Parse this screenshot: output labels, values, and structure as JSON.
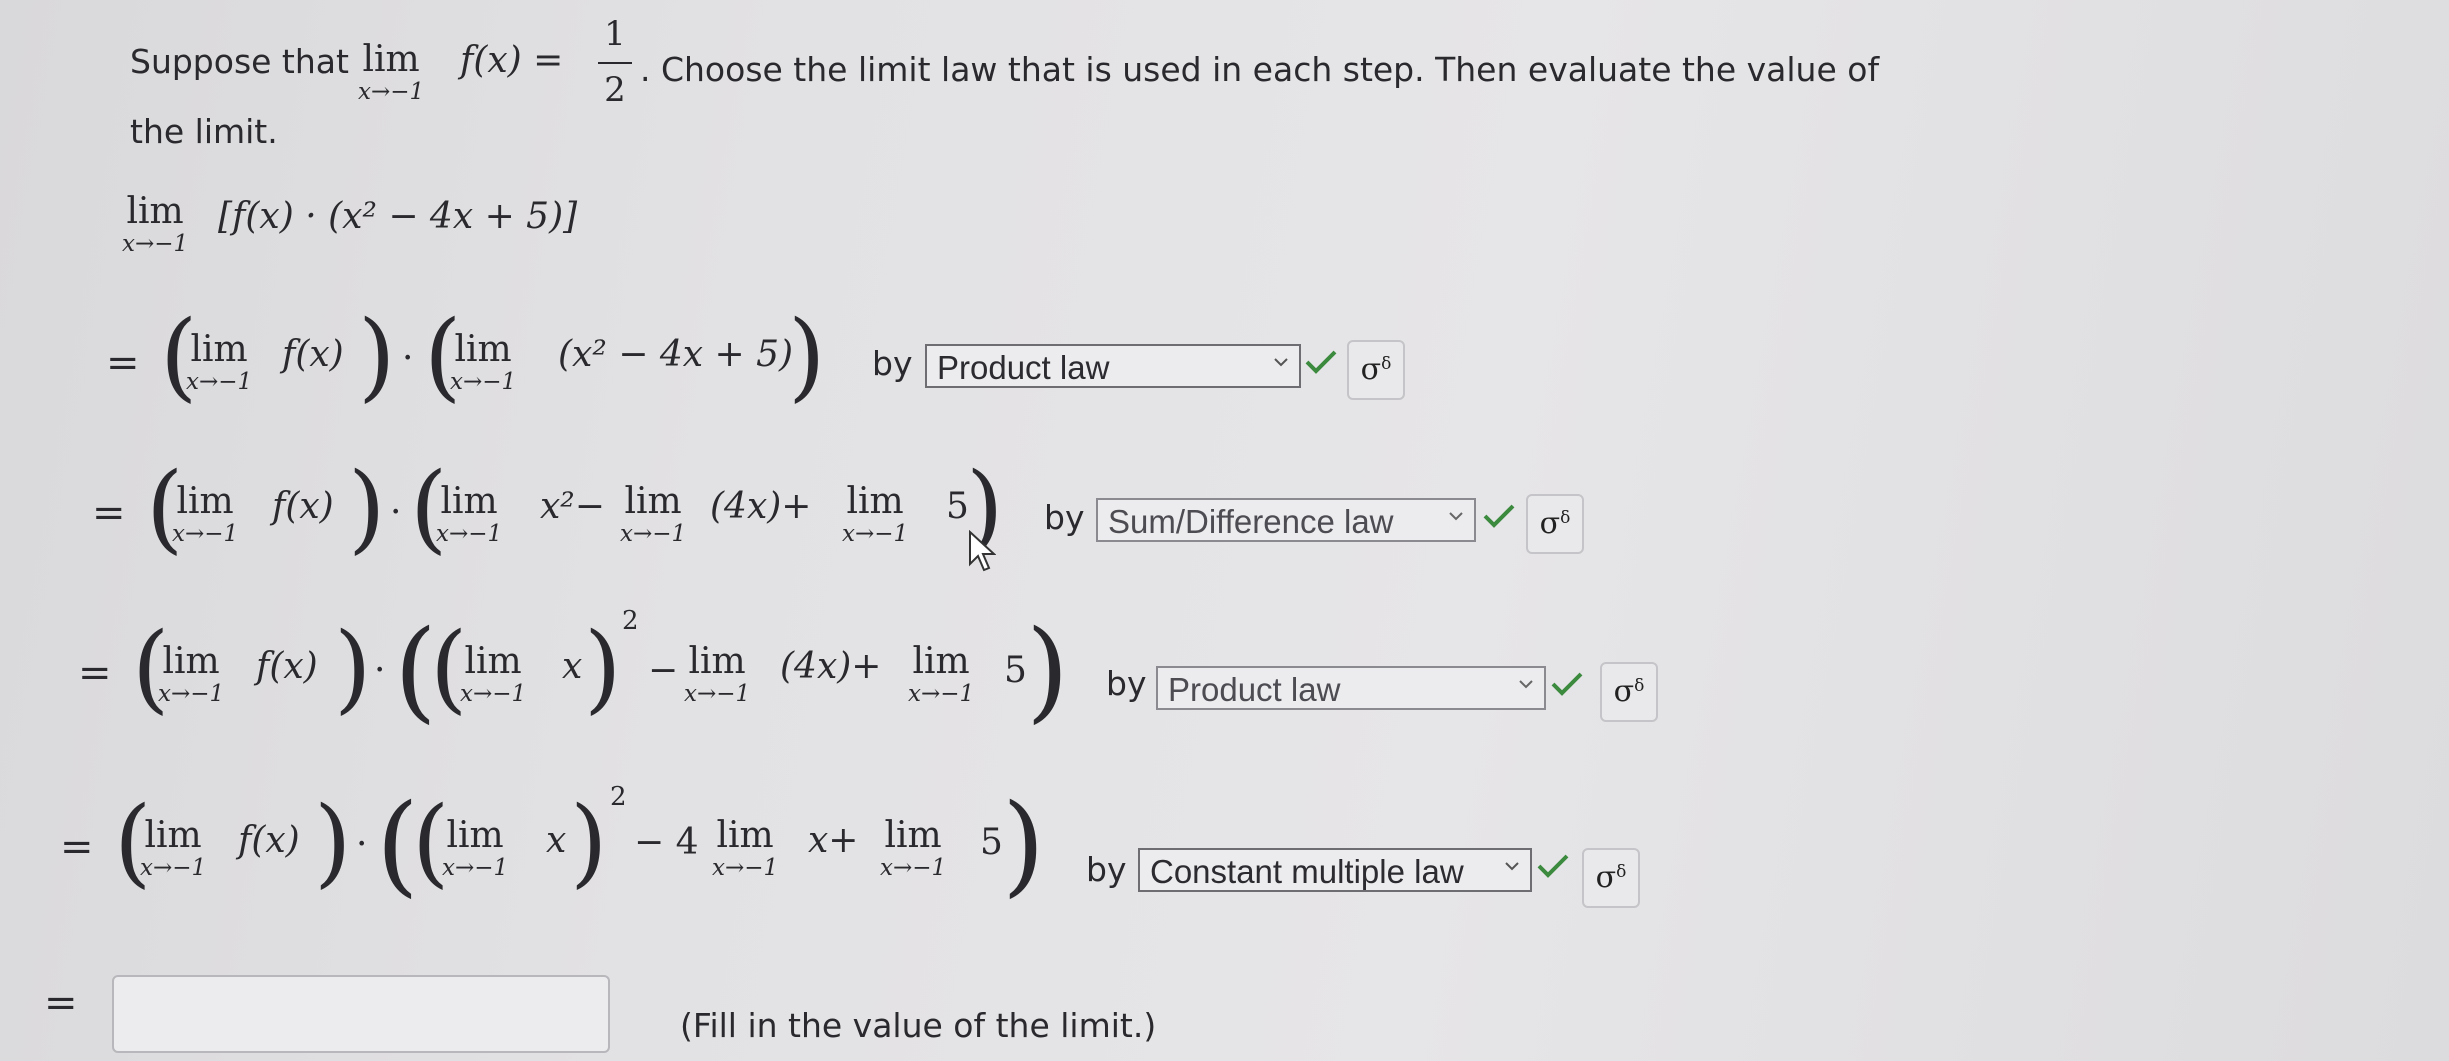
{
  "prompt": {
    "suppose": "Suppose that",
    "lim_word": "lim",
    "lim_sub": "x→−1",
    "fx_eq": "f(x) =",
    "frac_num": "1",
    "frac_den": "2",
    "rest": ". Choose the limit law that is used in each step. Then evaluate the value of",
    "line2": "the limit."
  },
  "math": {
    "lim": "lim",
    "sub": "x→−1",
    "expr": "[f(x) · (x² − 4x + 5)]",
    "fx": "f(x)",
    "quad": "(x² − 4x + 5)",
    "x2minus": "x²−",
    "fourx_plus": "(4x)+",
    "five": "5",
    "x": "x",
    "sq": "2",
    "minus": "−",
    "minus4": "− 4",
    "xplus": "x+",
    "dot": "·",
    "eq": "="
  },
  "steps": [
    {
      "by": "by",
      "law": "Product law"
    },
    {
      "by": "by",
      "law": "Sum/Difference law"
    },
    {
      "by": "by",
      "law": "Product law"
    },
    {
      "by": "by",
      "law": "Constant multiple law"
    }
  ],
  "key_icon": "key-icon",
  "key_glyph": "σ",
  "key_sup": "δ",
  "check_color": "#3b8a3e",
  "answer": {
    "value": "",
    "hint": "(Fill in the value of the limit.)"
  }
}
